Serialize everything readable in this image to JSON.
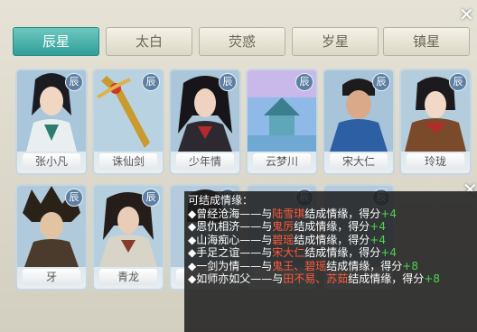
{
  "tabs": [
    {
      "label": "辰星",
      "active": true
    },
    {
      "label": "太白",
      "active": false
    },
    {
      "label": "荧惑",
      "active": false
    },
    {
      "label": "岁星",
      "active": false
    },
    {
      "label": "镇星",
      "active": false
    }
  ],
  "badge_label": "辰",
  "cards": [
    {
      "name": "张小凡"
    },
    {
      "name": "诛仙剑"
    },
    {
      "name": "少年情"
    },
    {
      "name": "云梦川"
    },
    {
      "name": "宋大仁"
    },
    {
      "name": "玲珑"
    },
    {
      "name": "牙"
    },
    {
      "name": "青龙"
    },
    {
      "name": ""
    },
    {
      "name": ""
    },
    {
      "name": ""
    }
  ],
  "tooltip": {
    "header": "可结成情缘：",
    "lines": [
      {
        "bullet": "◆",
        "title": "曾经沧海",
        "dash": "——与",
        "target": "陆雪琪",
        "mid": "结成情缘，得分",
        "score": "+4"
      },
      {
        "bullet": "◆",
        "title": "恩仇相济",
        "dash": "——与",
        "target": "鬼厉",
        "mid": "结成情缘，得分",
        "score": "+4"
      },
      {
        "bullet": "◆",
        "title": "山海痴心",
        "dash": "——与",
        "target": "碧瑶",
        "mid": "结成情缘，得分",
        "score": "+4"
      },
      {
        "bullet": "◆",
        "title": "手足之谊",
        "dash": "——与",
        "target": "宋大仁",
        "mid": "结成情缘，得分",
        "score": "+4"
      },
      {
        "bullet": "◆",
        "title": "一剑为情",
        "dash": "——与",
        "target": "鬼王、碧瑶",
        "mid": "结成情缘，得分",
        "score": "+8"
      },
      {
        "bullet": "◆",
        "title": "如师亦如父",
        "dash": "——与",
        "target": "田不易、苏茹",
        "mid": "结成情缘，得分",
        "score": "+8"
      }
    ]
  },
  "colors": {
    "accent_tab": "#2f9f97",
    "highlight_name": "#ff5a3a",
    "score_green": "#4fd24f",
    "badge": "#5c7fa3"
  }
}
